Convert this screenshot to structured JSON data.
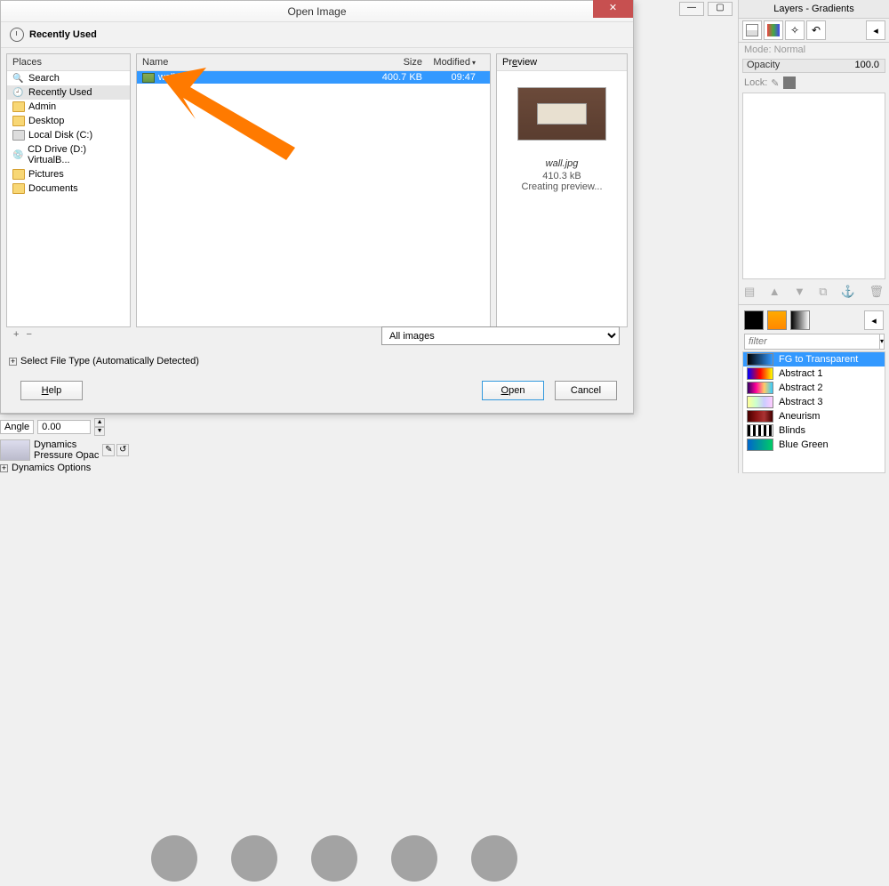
{
  "dialog": {
    "title": "Open Image",
    "recent_header": "Recently Used",
    "places_header": "Places",
    "places": [
      {
        "label": "Search",
        "icon": "search"
      },
      {
        "label": "Recently Used",
        "icon": "recent",
        "selected": true
      },
      {
        "label": "Admin",
        "icon": "folder"
      },
      {
        "label": "Desktop",
        "icon": "folder"
      },
      {
        "label": "Local Disk (C:)",
        "icon": "drive"
      },
      {
        "label": "CD Drive (D:) VirtualB...",
        "icon": "disc"
      },
      {
        "label": "Pictures",
        "icon": "folder"
      },
      {
        "label": "Documents",
        "icon": "folder"
      }
    ],
    "file_columns": {
      "name": "Name",
      "size": "Size",
      "modified": "Modified"
    },
    "files": [
      {
        "name": "wall.jpg",
        "size": "400.7 KB",
        "modified": "09:47",
        "selected": true
      }
    ],
    "preview": {
      "header": "Preview",
      "filename": "wall.jpg",
      "size": "410.3 kB",
      "status": "Creating preview..."
    },
    "add_btn": "+",
    "remove_btn": "−",
    "filter": {
      "value": "All images"
    },
    "expand_label": "Select File Type (Automatically Detected)",
    "help": "Help",
    "open": "Open",
    "cancel": "Cancel"
  },
  "right_dock": {
    "title": "Layers - Gradients",
    "mode_label": "Mode:",
    "mode_value": "Normal",
    "opacity_label": "Opacity",
    "opacity_value": "100.0",
    "lock_label": "Lock:",
    "filter_placeholder": "filter",
    "gradients": [
      {
        "name": "FG to Transparent",
        "cls": "g-fg",
        "selected": true
      },
      {
        "name": "Abstract 1",
        "cls": "g-a1"
      },
      {
        "name": "Abstract 2",
        "cls": "g-a2"
      },
      {
        "name": "Abstract 3",
        "cls": "g-a3"
      },
      {
        "name": "Aneurism",
        "cls": "g-an"
      },
      {
        "name": "Blinds",
        "cls": "g-bl"
      },
      {
        "name": "Blue Green",
        "cls": "g-bg"
      }
    ]
  },
  "main_peek": {
    "angle_label": "Angle",
    "angle_value": "0.00",
    "dynamics_label": "Dynamics",
    "preset": "Pressure Opac",
    "options_label": "Dynamics Options"
  }
}
